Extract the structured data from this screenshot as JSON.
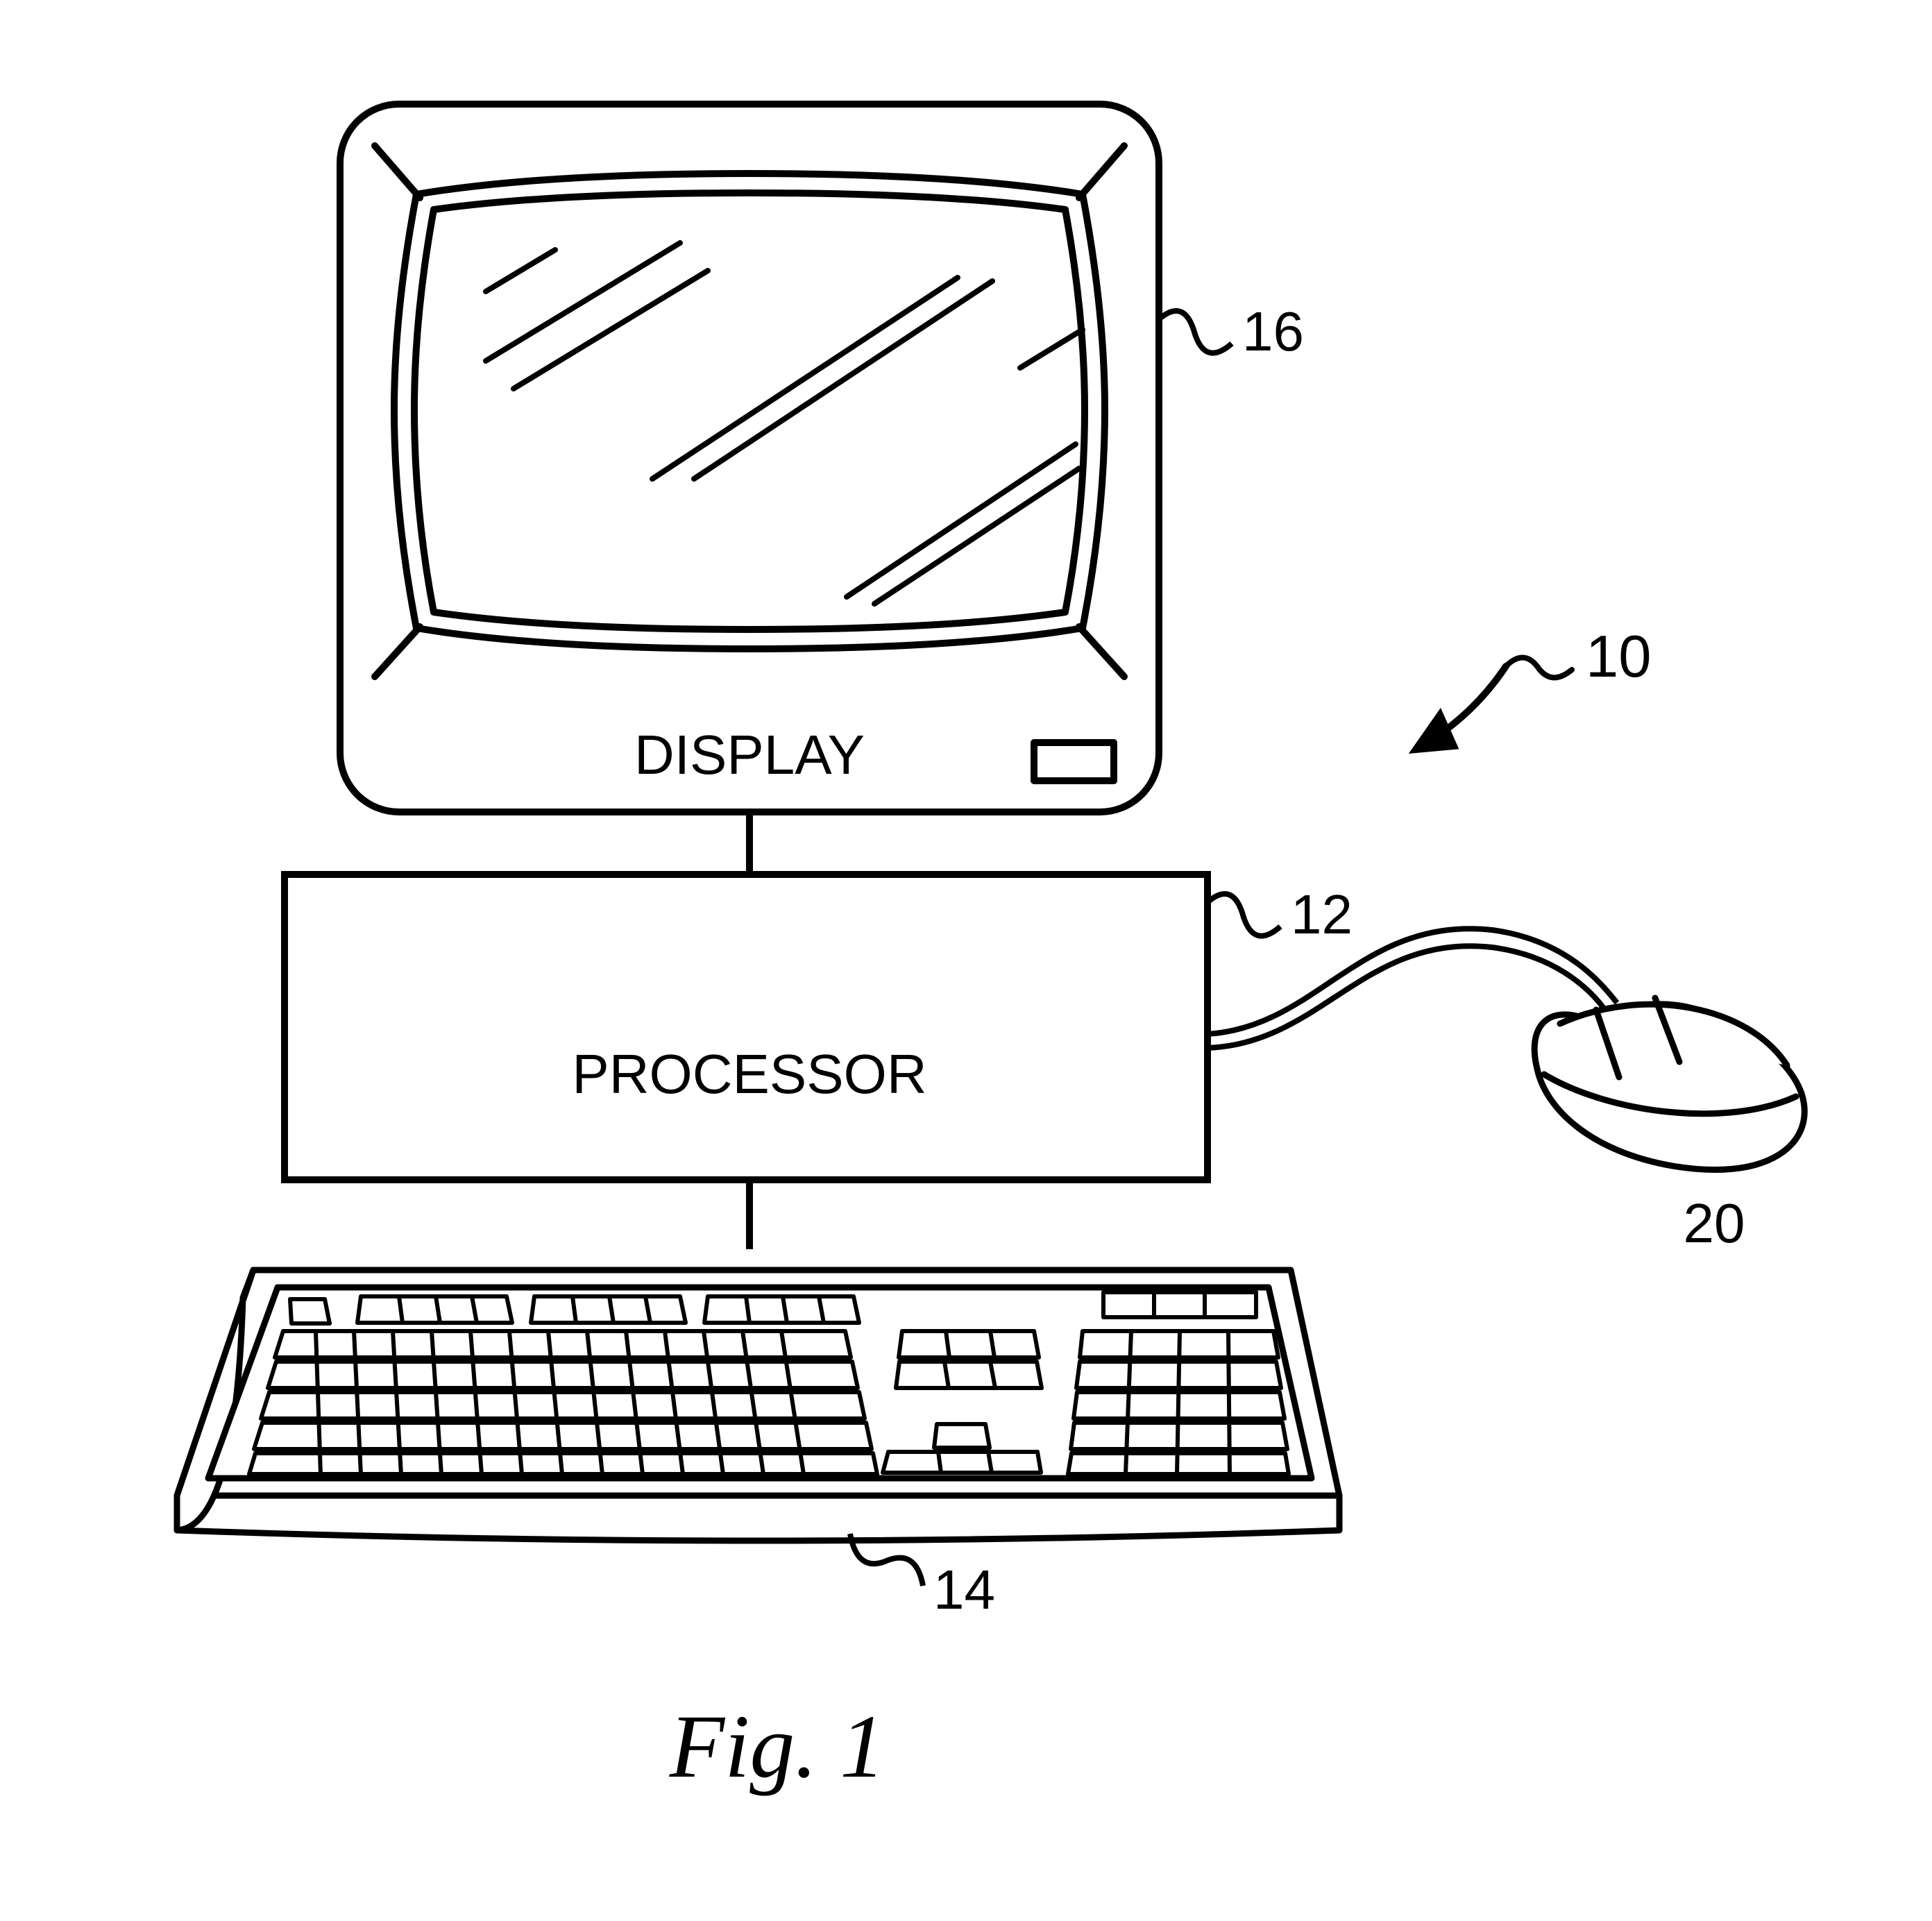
{
  "figure": {
    "caption": "Fig. 1",
    "assembly_ref": "10",
    "components": {
      "display": {
        "label": "DISPLAY",
        "ref": "16"
      },
      "processor": {
        "label": "PROCESSOR",
        "ref": "12"
      },
      "keyboard": {
        "ref": "14"
      },
      "mouse": {
        "ref": "20"
      }
    }
  }
}
